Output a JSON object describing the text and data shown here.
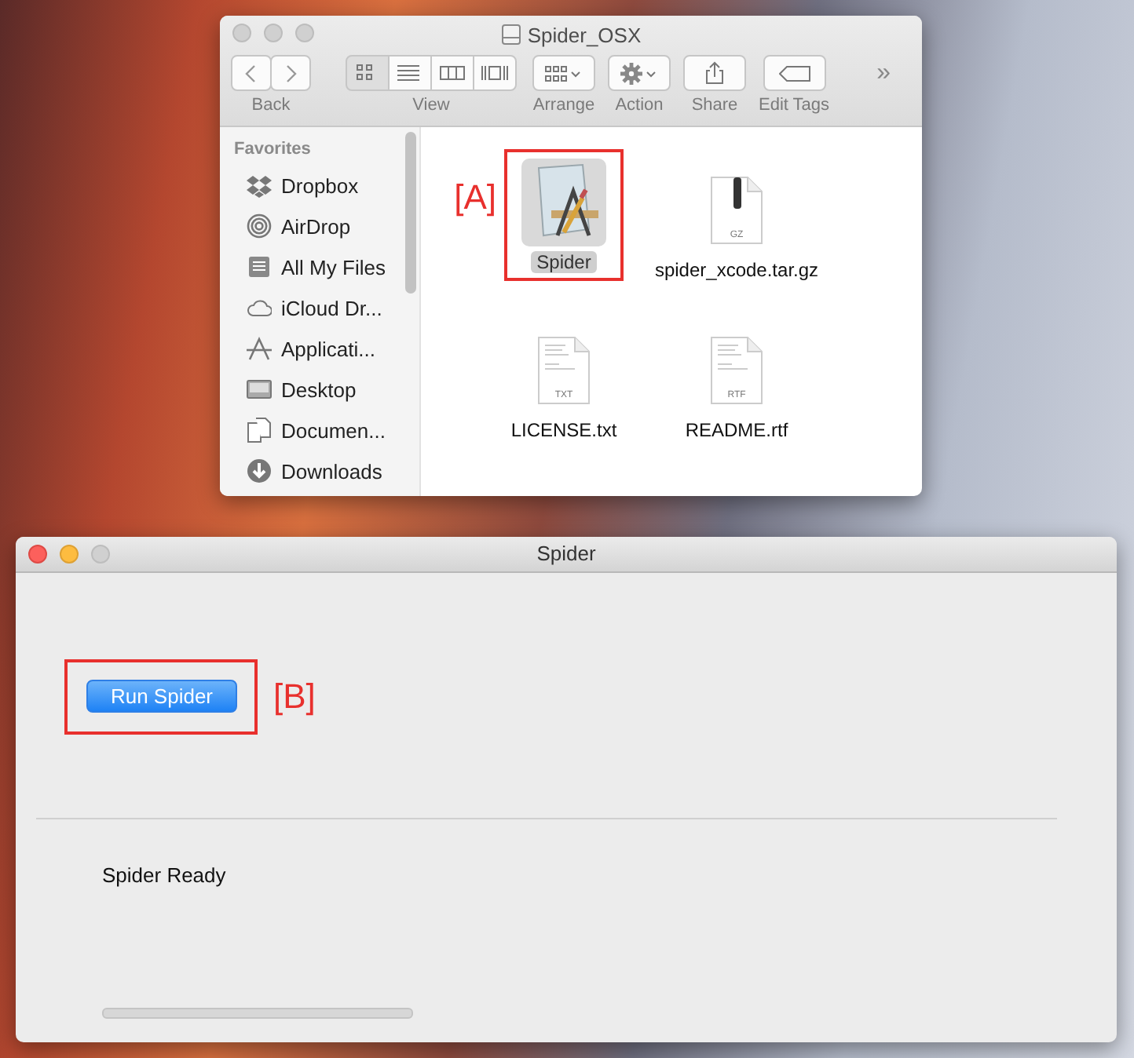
{
  "finder": {
    "title": "Spider_OSX",
    "toolbar": [
      {
        "label": "Back",
        "kind": "nav"
      },
      {
        "label": "View",
        "kind": "view",
        "segments": [
          {
            "selected": true
          },
          {
            "selected": false
          },
          {
            "selected": false
          },
          {
            "selected": false
          }
        ]
      },
      {
        "label": "Arrange",
        "kind": "arrange"
      },
      {
        "label": "Action",
        "kind": "action"
      },
      {
        "label": "Share",
        "kind": "share"
      },
      {
        "label": "Edit Tags",
        "kind": "tags"
      }
    ],
    "overflow": "»",
    "sidebar": {
      "heading": "Favorites",
      "items": [
        {
          "label": "Dropbox",
          "kind": "dropbox",
          "selected": false
        },
        {
          "label": "AirDrop",
          "kind": "airdrop",
          "selected": false
        },
        {
          "label": "All My Files",
          "kind": "files",
          "selected": false
        },
        {
          "label": "iCloud Dr...",
          "kind": "cloud",
          "selected": false
        },
        {
          "label": "Applicati...",
          "kind": "apps",
          "selected": false
        },
        {
          "label": "Desktop",
          "kind": "desktop",
          "selected": false
        },
        {
          "label": "Documen...",
          "kind": "documents",
          "selected": false
        },
        {
          "label": "Downloads",
          "kind": "downloads",
          "selected": false
        }
      ]
    },
    "files": [
      {
        "name": "Spider",
        "kind": "app",
        "selected": true,
        "annotation": "[A]"
      },
      {
        "name": "spider_xcode.tar.gz",
        "kind": "archive",
        "badge": "GZ",
        "selected": false
      },
      {
        "name": "LICENSE.txt",
        "kind": "document",
        "badge": "TXT",
        "selected": false
      },
      {
        "name": "README.rtf",
        "kind": "document",
        "badge": "RTF",
        "selected": false
      }
    ]
  },
  "app_window": {
    "title": "Spider",
    "button": {
      "label": "Run Spider",
      "annotation": "[B]"
    },
    "status": "Spider Ready",
    "progress": {
      "level": 0
    }
  }
}
